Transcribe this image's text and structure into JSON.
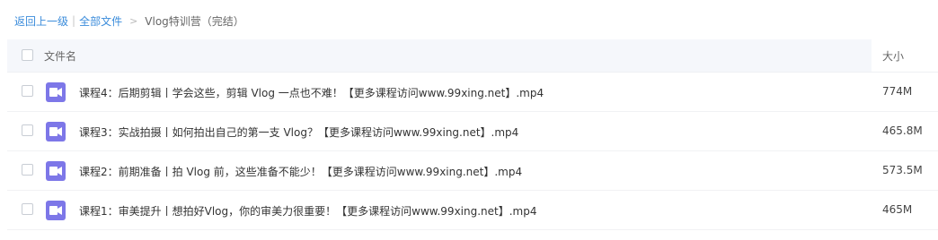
{
  "breadcrumb": {
    "back_label": "返回上一级",
    "separator": "|",
    "all_files_label": "全部文件",
    "arrow": ">",
    "current_folder": "Vlog特训营（完结）"
  },
  "table": {
    "headers": {
      "name": "文件名",
      "size": "大小"
    },
    "rows": [
      {
        "icon": "video-file-icon",
        "name": "课程4：后期剪辑丨学会这些，剪辑 Vlog 一点也不难！【更多课程访问www.99xing.net】.mp4",
        "size": "774M"
      },
      {
        "icon": "video-file-icon",
        "name": "课程3：实战拍摄丨如何拍出自己的第一支 Vlog？【更多课程访问www.99xing.net】.mp4",
        "size": "465.8M"
      },
      {
        "icon": "video-file-icon",
        "name": "课程2：前期准备丨拍 Vlog 前，这些准备不能少！【更多课程访问www.99xing.net】.mp4",
        "size": "573.5M"
      },
      {
        "icon": "video-file-icon",
        "name": "课程1：审美提升丨想拍好Vlog，你的审美力很重要！【更多课程访问www.99xing.net】.mp4",
        "size": "465M"
      }
    ]
  },
  "colors": {
    "link": "#3b8cdb",
    "video_icon": "#7d77e8",
    "header_bg": "#f5f7fb"
  }
}
